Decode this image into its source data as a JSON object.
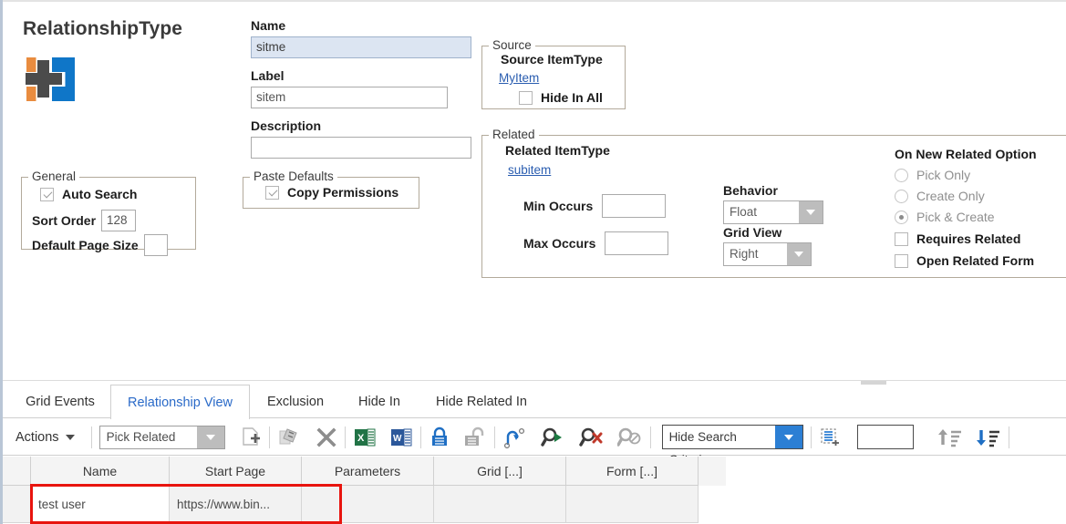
{
  "header": {
    "title": "RelationshipType",
    "logo_icon": "cross-plus-logo-icon"
  },
  "fields": {
    "name_label": "Name",
    "name_value": "sitme",
    "label_label": "Label",
    "label_value": "sitem",
    "description_label": "Description",
    "description_value": ""
  },
  "general": {
    "legend": "General",
    "auto_search_label": "Auto Search",
    "auto_search_checked": true,
    "sort_order_label": "Sort Order",
    "sort_order_value": "128",
    "default_page_size_label": "Default Page Size",
    "default_page_size_value": ""
  },
  "paste_defaults": {
    "legend": "Paste Defaults",
    "copy_permissions_label": "Copy Permissions",
    "copy_permissions_checked": true
  },
  "source": {
    "legend": "Source",
    "item_type_label": "Source ItemType",
    "item_type_link": "MyItem",
    "hide_in_all_label": "Hide In All",
    "hide_in_all_checked": false
  },
  "related": {
    "legend": "Related",
    "item_type_label": "Related ItemType",
    "item_type_link": "subitem",
    "min_occurs_label": "Min Occurs",
    "min_occurs_value": "",
    "max_occurs_label": "Max Occurs",
    "max_occurs_value": "",
    "behavior_label": "Behavior",
    "behavior_value": "Float",
    "grid_view_label": "Grid View",
    "grid_view_value": "Right"
  },
  "on_new_related": {
    "title": "On New Related Option",
    "options": [
      {
        "label": "Pick Only",
        "selected": false
      },
      {
        "label": "Create Only",
        "selected": false
      },
      {
        "label": "Pick & Create",
        "selected": true
      }
    ],
    "requires_related_label": "Requires Related",
    "requires_related_checked": false,
    "open_related_form_label": "Open Related Form",
    "open_related_form_checked": false
  },
  "tabs": [
    {
      "label": "Grid Events",
      "active": false
    },
    {
      "label": "Relationship View",
      "active": true
    },
    {
      "label": "Exclusion",
      "active": false
    },
    {
      "label": "Hide In",
      "active": false
    },
    {
      "label": "Hide Related In",
      "active": false
    }
  ],
  "toolbar": {
    "actions_label": "Actions",
    "pick_related_value": "Pick Related",
    "hide_search_criteria_value": "Hide Search Criteria",
    "page_size_value": "",
    "icons": [
      "new-item-icon",
      "cut-paste-icon",
      "delete-x-icon",
      "export-excel-icon",
      "export-word-icon",
      "lock-icon",
      "unlock-icon",
      "promote-arrow-icon",
      "run-search-icon",
      "clear-search-icon",
      "disabled-search-icon",
      "insert-row-icon",
      "sort-ascending-icon",
      "sort-descending-icon"
    ]
  },
  "grid": {
    "columns": [
      "Name",
      "Start Page",
      "Parameters",
      "Grid [...]",
      "Form [...]"
    ],
    "rows": [
      {
        "cells": [
          "test user",
          "https://www.bin...",
          "",
          "",
          ""
        ]
      }
    ],
    "highlight_color": "#e8140e"
  },
  "colors": {
    "accent_blue": "#2a6ac8",
    "link_blue": "#2a5db0",
    "logo_orange": "#e98c3f",
    "logo_blue": "#0f76c8",
    "logo_gray": "#4b4b4b",
    "excel_green": "#217346",
    "word_blue": "#2b579a"
  }
}
